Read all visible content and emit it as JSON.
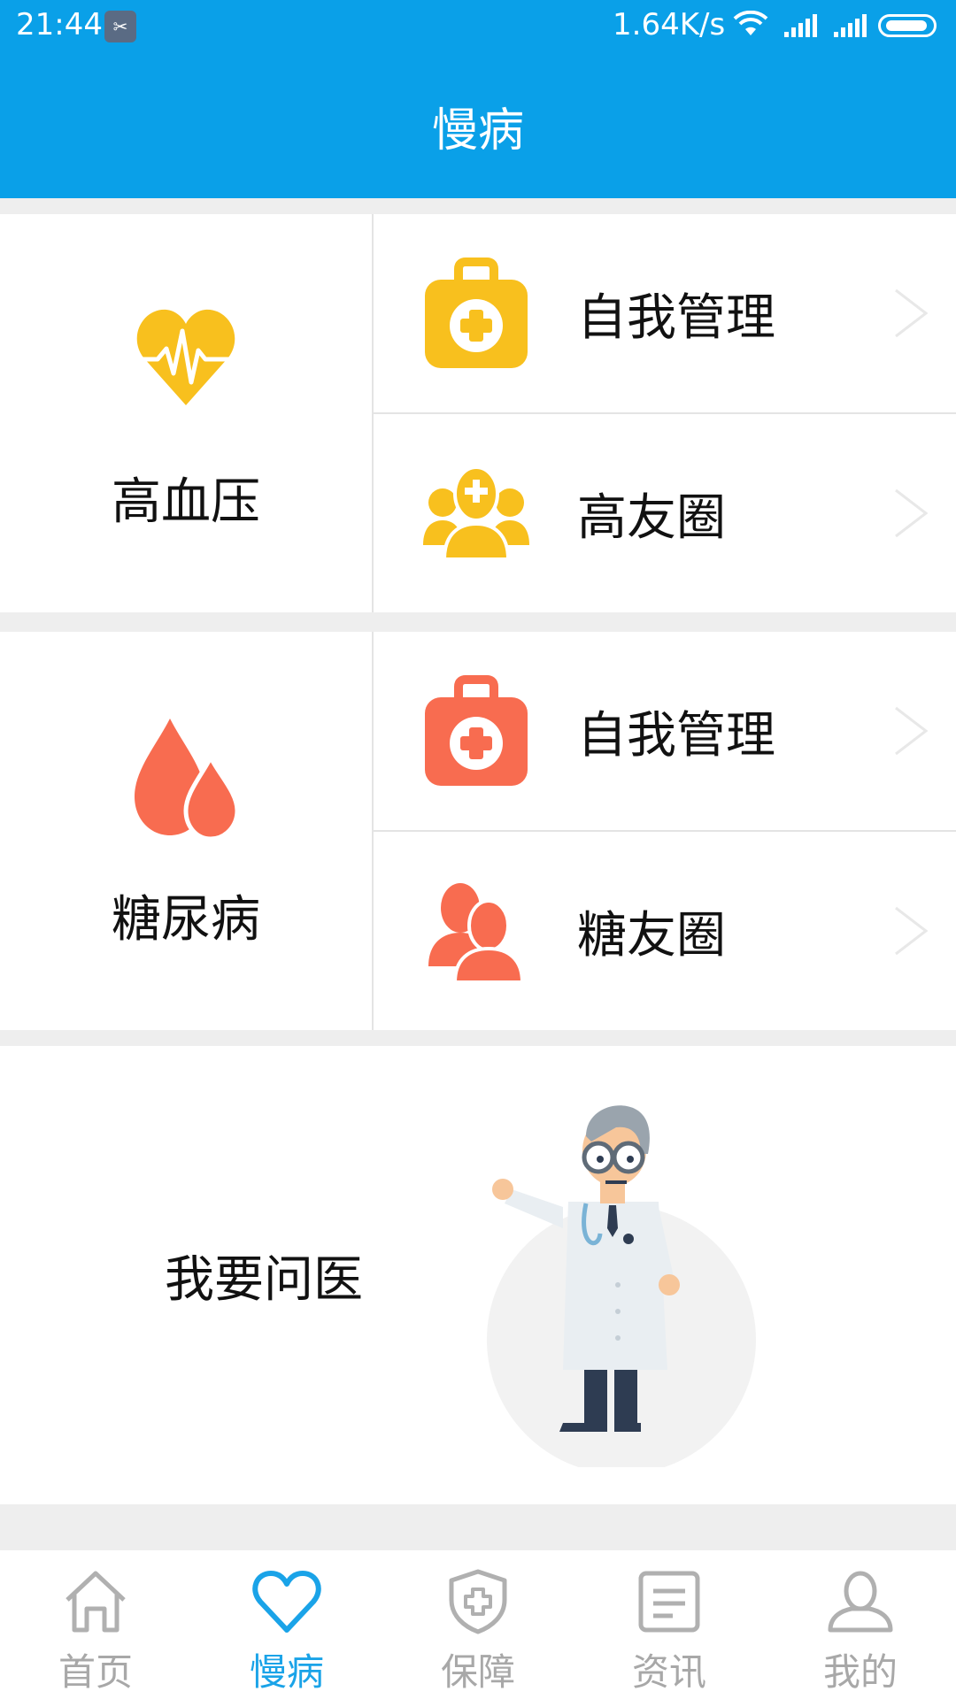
{
  "status_bar": {
    "time": "21:44",
    "speed": "1.64K/s"
  },
  "header": {
    "title": "慢病"
  },
  "hypertension": {
    "label": "高血压",
    "color": "#f8c01e",
    "items": [
      {
        "label": "自我管理"
      },
      {
        "label": "高友圈"
      }
    ]
  },
  "diabetes": {
    "label": "糖尿病",
    "color": "#f86c50",
    "items": [
      {
        "label": "自我管理"
      },
      {
        "label": "糖友圈"
      }
    ]
  },
  "ask_doctor": {
    "label": "我要问医"
  },
  "tabs": [
    {
      "label": "首页",
      "icon": "home-icon",
      "active": false
    },
    {
      "label": "慢病",
      "icon": "heart-icon",
      "active": true
    },
    {
      "label": "保障",
      "icon": "shield-icon",
      "active": false
    },
    {
      "label": "资讯",
      "icon": "news-icon",
      "active": false
    },
    {
      "label": "我的",
      "icon": "profile-icon",
      "active": false
    }
  ],
  "colors": {
    "primary": "#0aa0e8",
    "tab_active": "#1aa3e8",
    "tab_inactive": "#a8a8a8"
  }
}
